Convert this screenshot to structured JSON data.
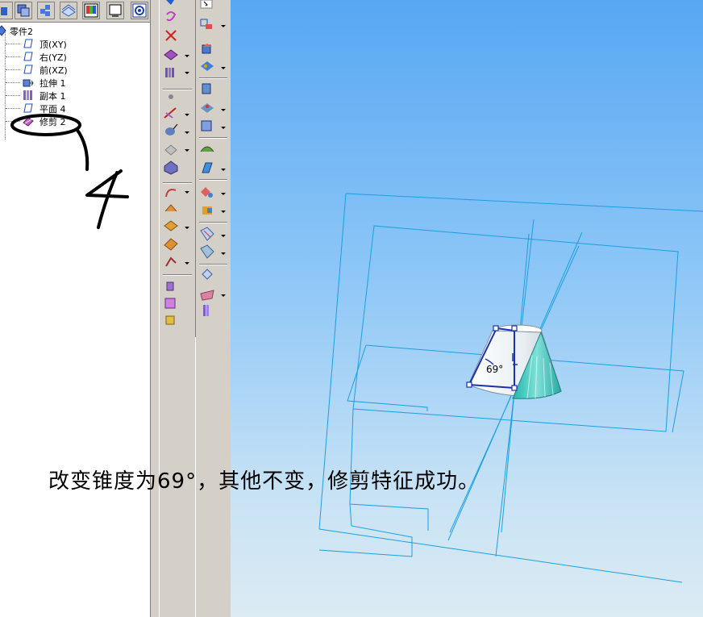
{
  "tree": {
    "root": "零件2",
    "items": [
      {
        "label": "顶(XY)",
        "icon": "plane-icon"
      },
      {
        "label": "右(YZ)",
        "icon": "plane-icon"
      },
      {
        "label": "前(XZ)",
        "icon": "plane-icon"
      },
      {
        "label": "拉伸 1",
        "icon": "extrude-icon"
      },
      {
        "label": "副本 1",
        "icon": "copy-icon"
      },
      {
        "label": "平面 4",
        "icon": "plane-icon"
      },
      {
        "label": "修剪 2",
        "icon": "trim-icon"
      }
    ]
  },
  "annotation": {
    "handwritten_number": "4",
    "caption": "改变锥度为69°，其他不变，修剪特征成功。"
  },
  "viewport": {
    "angle_label": "69°"
  },
  "colors": {
    "viewport_top": "#57a7f3",
    "viewport_bottom": "#dcebf3",
    "wireframe": "#1aa0e0",
    "toolbar": "#d4d0c8"
  }
}
